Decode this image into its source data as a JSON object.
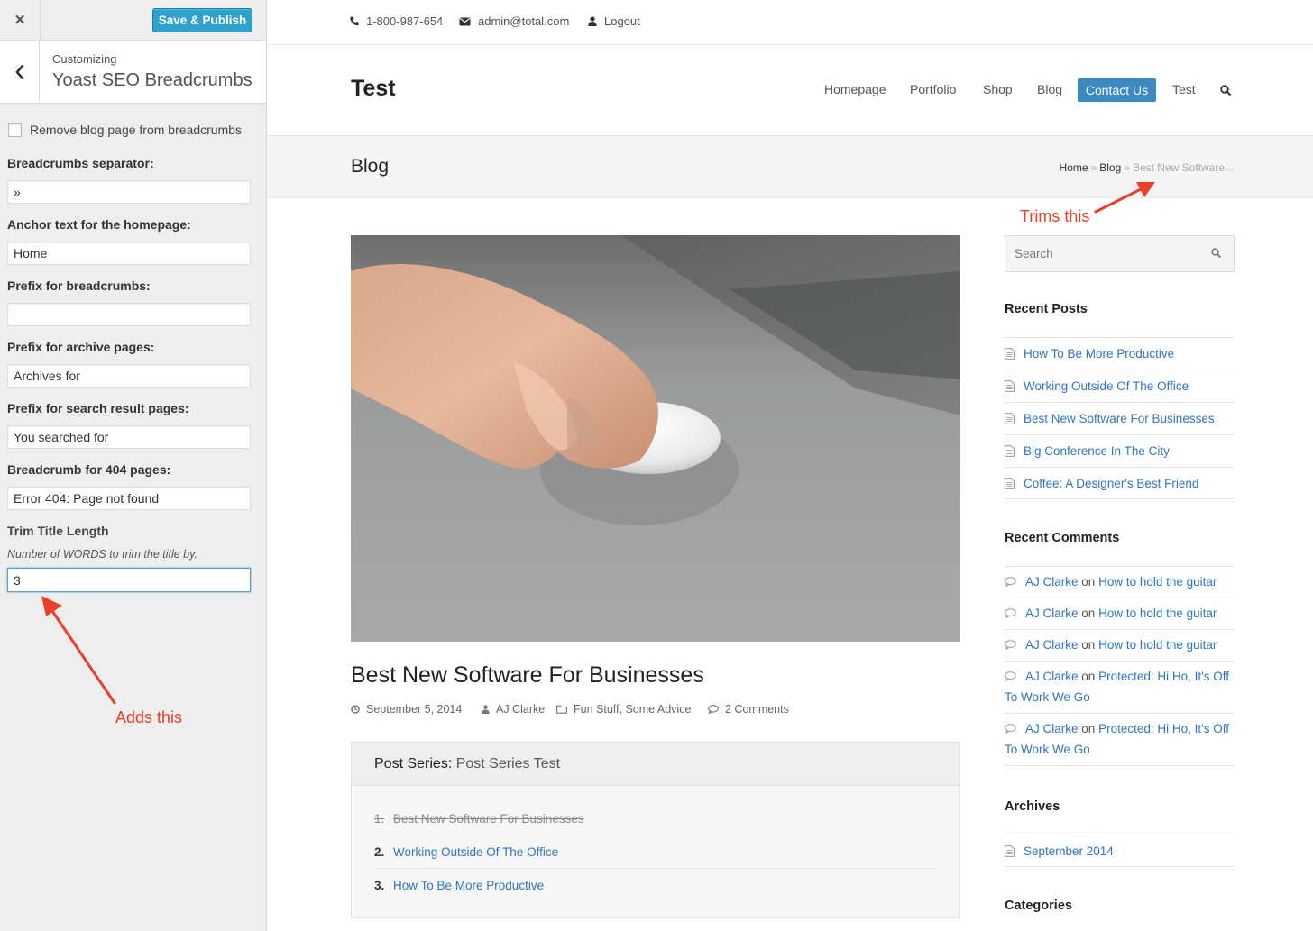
{
  "customizer": {
    "close_icon": "×",
    "publish_label": "Save & Publish",
    "customizing_label": "Customizing",
    "section_title": "Yoast SEO Breadcrumbs",
    "remove_blog_label": "Remove blog page from breadcrumbs",
    "remove_blog_checked": false,
    "fields": [
      {
        "label": "Breadcrumbs separator:",
        "value": "»"
      },
      {
        "label": "Anchor text for the homepage:",
        "value": "Home"
      },
      {
        "label": "Prefix for breadcrumbs:",
        "value": ""
      },
      {
        "label": "Prefix for archive pages:",
        "value": "Archives for"
      },
      {
        "label": "Prefix for search result pages:",
        "value": "You searched for"
      },
      {
        "label": "Breadcrumb for 404 pages:",
        "value": "Error 404: Page not found"
      }
    ],
    "trim": {
      "label": "Trim Title Length",
      "description": "Number of WORDS to trim the title by.",
      "value": "3"
    }
  },
  "annotations": {
    "trims_this": "Trims this",
    "adds_this": "Adds this",
    "arrow_color": "#e8402a"
  },
  "site": {
    "topbar": {
      "phone": "1-800-987-654",
      "email": "admin@total.com",
      "logout": "Logout"
    },
    "logo": "Test",
    "nav": [
      "Homepage",
      "Portfolio",
      "Shop",
      "Blog",
      "Contact Us",
      "Test"
    ],
    "nav_active": "Contact Us",
    "accent_color": "#3d8ac2",
    "page_title": "Blog",
    "breadcrumbs": {
      "home": "Home",
      "sep": "»",
      "blog": "Blog",
      "current": "Best New Software..."
    }
  },
  "post": {
    "title": "Best New Software For Businesses",
    "date": "September 5, 2014",
    "author": "AJ Clarke",
    "categories": "Fun Stuff, Some Advice",
    "comments": "2 Comments",
    "series": {
      "label": "Post Series:",
      "name": "Post Series Test",
      "items": [
        {
          "num": "1.",
          "title": "Best New Software For Businesses",
          "current": true
        },
        {
          "num": "2.",
          "title": "Working Outside Of The Office",
          "current": false
        },
        {
          "num": "3.",
          "title": "How To Be More Productive",
          "current": false
        }
      ]
    }
  },
  "sidebar": {
    "search_placeholder": "Search",
    "recent_posts_title": "Recent Posts",
    "recent_posts": [
      "How To Be More Productive",
      "Working Outside Of The Office",
      "Best New Software For Businesses",
      "Big Conference In The City",
      "Coffee: A Designer's Best Friend"
    ],
    "recent_comments_title": "Recent Comments",
    "recent_comments": [
      {
        "author": "AJ Clarke",
        "on": "on",
        "post": "How to hold the guitar"
      },
      {
        "author": "AJ Clarke",
        "on": "on",
        "post": "How to hold the guitar"
      },
      {
        "author": "AJ Clarke",
        "on": "on",
        "post": "How to hold the guitar"
      },
      {
        "author": "AJ Clarke",
        "on": "on",
        "post": "Protected: Hi Ho, It's Off To Work We Go"
      },
      {
        "author": "AJ Clarke",
        "on": "on",
        "post": "Protected: Hi Ho, It's Off To Work We Go"
      }
    ],
    "archives_title": "Archives",
    "archives": [
      "September 2014"
    ],
    "categories_title": "Categories"
  }
}
